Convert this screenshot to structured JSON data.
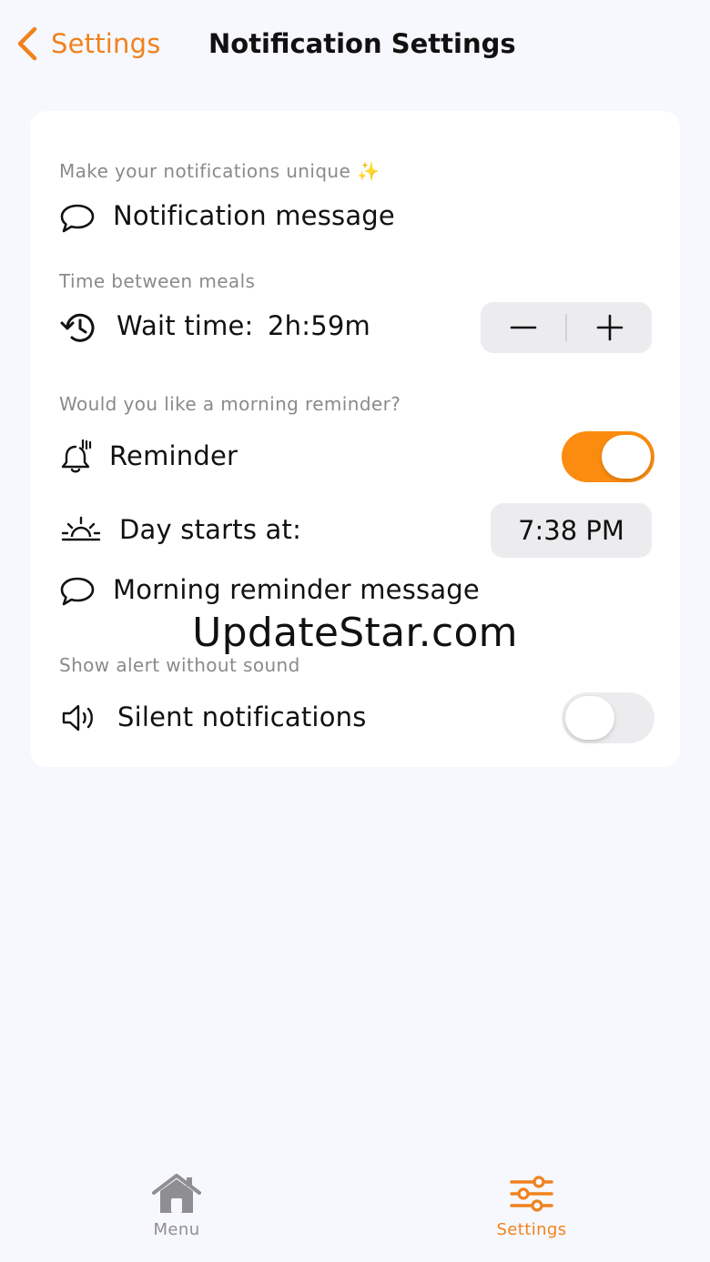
{
  "colors": {
    "accent": "#f0821e",
    "toggle_on": "#fb8c10",
    "background": "#f7f8fd",
    "inactive_tab": "#8e8e93"
  },
  "header": {
    "back_label": "Settings",
    "back_icon": "chevron-left-icon",
    "title": "Notification Settings"
  },
  "sections": {
    "unique": {
      "caption": "Make your notifications unique ✨",
      "message_label": "Notification message",
      "icon": "speech-bubble-icon"
    },
    "meals": {
      "caption": "Time between meals",
      "wait_label": "Wait time:",
      "wait_value": "2h:59m",
      "icon": "clock-history-icon",
      "stepper_minus": "−",
      "stepper_plus": "+"
    },
    "morning": {
      "caption": "Would you like a morning reminder?",
      "reminder_label": "Reminder",
      "reminder_on": true,
      "reminder_icon": "bell-icon",
      "day_start_label": "Day starts at:",
      "day_start_value": "7:38 PM",
      "day_start_icon": "sunrise-icon",
      "morning_message_label": "Morning reminder message",
      "morning_message_icon": "speech-bubble-icon"
    },
    "silent": {
      "caption": "Show alert without sound",
      "silent_label": "Silent notifications",
      "silent_on": false,
      "icon": "speaker-icon"
    }
  },
  "watermark": "UpdateStar.com",
  "tabbar": {
    "tabs": [
      {
        "label": "Menu",
        "icon": "house-icon",
        "active": false
      },
      {
        "label": "Settings",
        "icon": "sliders-icon",
        "active": true
      }
    ]
  }
}
